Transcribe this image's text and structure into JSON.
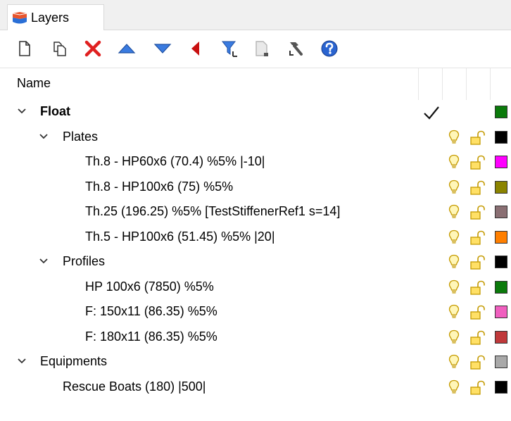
{
  "panel": {
    "tab_label": "Layers",
    "tab_icon": "layers-icon"
  },
  "toolbar": {
    "buttons": [
      {
        "name": "new-layer-button",
        "icon": "new-document-icon"
      },
      {
        "name": "new-sublayer-button",
        "icon": "new-sublayer-icon"
      },
      {
        "name": "delete-layer-button",
        "icon": "delete-x-icon",
        "color": "#e02020"
      },
      {
        "name": "move-up-button",
        "icon": "triangle-up-icon",
        "color": "#2a6fd6"
      },
      {
        "name": "move-down-button",
        "icon": "triangle-down-icon",
        "color": "#2a6fd6"
      },
      {
        "name": "move-to-parent-button",
        "icon": "triangle-left-icon",
        "color": "#c81010"
      },
      {
        "name": "filter-button",
        "icon": "filter-icon",
        "color": "#2a6fd6"
      },
      {
        "name": "layer-copy-button",
        "icon": "document-icon"
      },
      {
        "name": "tools-button",
        "icon": "hammer-icon"
      },
      {
        "name": "help-button",
        "icon": "help-icon",
        "color": "#2a6fd6"
      }
    ]
  },
  "columns": {
    "name": "Name"
  },
  "layers": [
    {
      "label": "Float",
      "level": 0,
      "expandable": true,
      "bold": true,
      "current": true,
      "color": "#0b7a0b"
    },
    {
      "label": "Plates",
      "level": 1,
      "expandable": true,
      "color": "#000000"
    },
    {
      "label": "Th.8 - HP60x6 (70.4) %5% |-10|",
      "level": 2,
      "color": "#ff00ff"
    },
    {
      "label": "Th.8 - HP100x6 (75) %5%",
      "level": 2,
      "color": "#8b8400"
    },
    {
      "label": "Th.25 (196.25) %5% [TestStiffenerRef1 s=14]",
      "level": 2,
      "color": "#8a6f73"
    },
    {
      "label": "Th.5 - HP100x6 (51.45) %5% |20|",
      "level": 2,
      "color": "#ff7f00"
    },
    {
      "label": "Profiles",
      "level": 1,
      "expandable": true,
      "color": "#000000"
    },
    {
      "label": "HP 100x6 (7850) %5%",
      "level": 2,
      "color": "#0b7a0b"
    },
    {
      "label": "F: 150x11 (86.35) %5%",
      "level": 2,
      "color": "#f05fbf"
    },
    {
      "label": "F: 180x11 (86.35) %5%",
      "level": 2,
      "color": "#c0393b"
    },
    {
      "label": "Equipments",
      "level": 0,
      "expandable": true,
      "color": "#a9a9a9"
    },
    {
      "label": "Rescue Boats (180) |500|",
      "level": 1,
      "color": "#000000"
    }
  ]
}
